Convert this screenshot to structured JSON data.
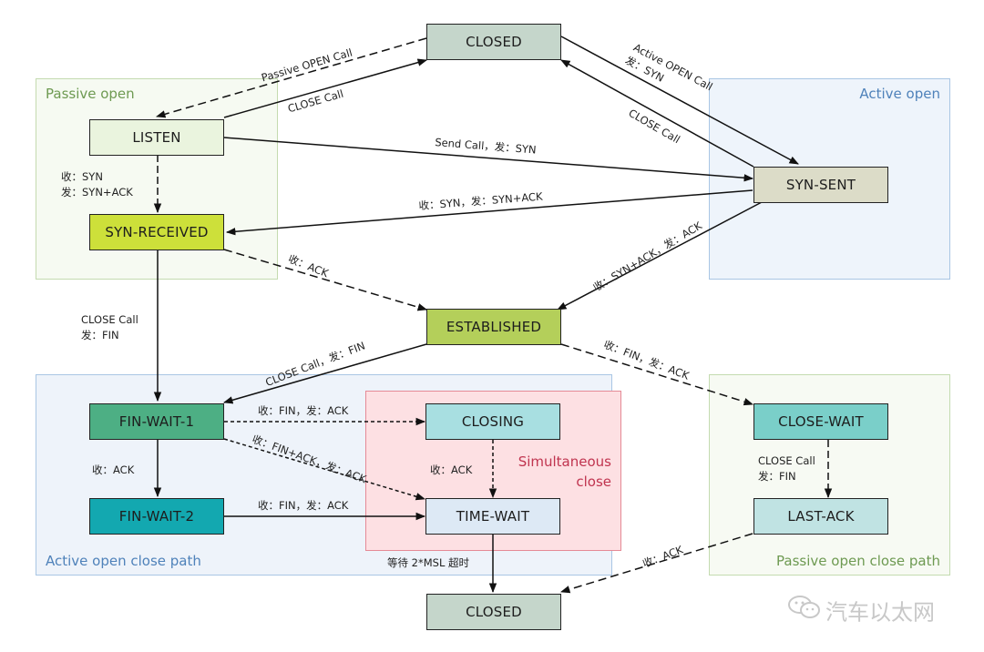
{
  "regions": {
    "passive_open": {
      "label": "Passive open",
      "color": "#6e9a52",
      "fill": "#f6faf2",
      "border": "#c4dbb0"
    },
    "active_open": {
      "label": "Active open",
      "color": "#4f82ba",
      "fill": "#eef4fb",
      "border": "#a9c6e4"
    },
    "active_close": {
      "label": "Active open close path",
      "color": "#4f82ba",
      "fill": "#eef3fa",
      "border": "#a9c6e4"
    },
    "simultaneous": {
      "label_line1": "Simultaneous",
      "label_line2": "close",
      "color": "#c0344f",
      "fill": "#fde0e3",
      "border": "#e58a96"
    },
    "passive_close": {
      "label": "Passive open close path",
      "color": "#6e9a52",
      "fill": "#f7faf3",
      "border": "#c4dbb0"
    }
  },
  "states": {
    "closed_top": {
      "label": "CLOSED",
      "color": "#c5d6cb"
    },
    "listen": {
      "label": "LISTEN",
      "color": "#eaf4de"
    },
    "syn_received": {
      "label": "SYN-RECEIVED",
      "color": "#cde03a"
    },
    "syn_sent": {
      "label": "SYN-SENT",
      "color": "#dcdcc8"
    },
    "established": {
      "label": "ESTABLISHED",
      "color": "#b4cf5a"
    },
    "fin_wait_1": {
      "label": "FIN-WAIT-1",
      "color": "#4daf84"
    },
    "fin_wait_2": {
      "label": "FIN-WAIT-2",
      "color": "#13a8b0"
    },
    "closing": {
      "label": "CLOSING",
      "color": "#a8dfe1"
    },
    "time_wait": {
      "label": "TIME-WAIT",
      "color": "#dde9f5"
    },
    "close_wait": {
      "label": "CLOSE-WAIT",
      "color": "#7acfc9"
    },
    "last_ack": {
      "label": "LAST-ACK",
      "color": "#c0e3e3"
    },
    "closed_bottom": {
      "label": "CLOSED",
      "color": "#c5d6cb"
    }
  },
  "transitions": {
    "passive_open_call": "Passive OPEN Call",
    "close_call_listen": "CLOSE Call",
    "active_open_call_1": "Active OPEN Call",
    "active_open_call_2": "发：SYN",
    "close_call_synsent": "CLOSE Call",
    "send_call": "Send Call，发：SYN",
    "listen_to_synrcvd_1": "收：SYN",
    "listen_to_synrcvd_2": "发：SYN+ACK",
    "synsent_to_synrcvd": "收：SYN，发：SYN+ACK",
    "synrcvd_to_est": "收：ACK",
    "synsent_to_est": "收：SYN+ACK，发：ACK",
    "synrcvd_to_fw1_1": "CLOSE Call",
    "synrcvd_to_fw1_2": "发：FIN",
    "est_to_fw1": "CLOSE Call，发：FIN",
    "est_to_closewait": "收：FIN，发：ACK",
    "fw1_to_closing": "收：FIN，发：ACK",
    "fw1_to_timewait": "收：FIN+ACK，发：ACK",
    "fw1_to_fw2": "收：ACK",
    "fw2_to_timewait": "收：FIN，发：ACK",
    "closing_to_timewait": "收：ACK",
    "timewait_to_closed": "等待 2*MSL 超时",
    "closewait_to_lastack_1": "CLOSE Call",
    "closewait_to_lastack_2": "发：FIN",
    "lastack_to_closed": "收：ACK"
  },
  "watermark": {
    "icon": "wechat-icon",
    "text": "汽车以太网"
  }
}
